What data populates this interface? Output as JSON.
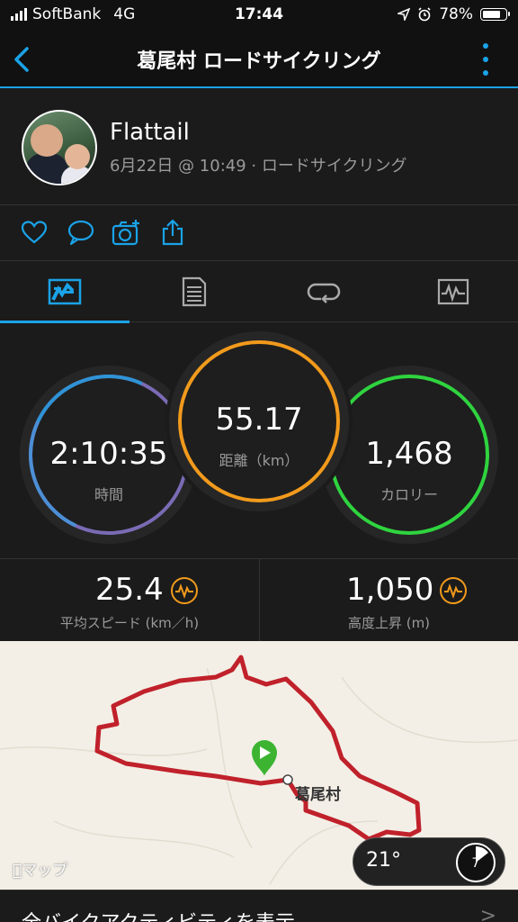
{
  "status": {
    "carrier": "SoftBank",
    "network": "4G",
    "time": "17:44",
    "battery": "78%",
    "battery_level": 0.78
  },
  "nav": {
    "title": "葛尾村 ロードサイクリング"
  },
  "profile": {
    "name": "Flattail",
    "meta": "6月22日 @ 10:49 · ロードサイクリング"
  },
  "actions": [
    "heart-icon",
    "comment-icon",
    "camera-add-icon",
    "share-icon"
  ],
  "tabs": [
    {
      "id": "summary",
      "icon": "summary-icon",
      "active": true
    },
    {
      "id": "details",
      "icon": "details-icon",
      "active": false
    },
    {
      "id": "laps",
      "icon": "laps-icon",
      "active": false
    },
    {
      "id": "charts",
      "icon": "charts-icon",
      "active": false
    }
  ],
  "stats": {
    "time": {
      "value": "2:10:35",
      "label": "時間",
      "color": "#7b6bb5"
    },
    "distance": {
      "value": "55.17",
      "label": "距離（km）",
      "color": "#f19a1c"
    },
    "calories": {
      "value": "1,468",
      "label": "カロリー",
      "color": "#2fd43f"
    }
  },
  "secondary": {
    "speed": {
      "value": "25.4",
      "label": "平均スピード (km／h)"
    },
    "elevation": {
      "value": "1,050",
      "label": "高度上昇 (m)"
    }
  },
  "map": {
    "town": "葛尾村",
    "maps_label": "マップ",
    "temperature": "21°",
    "wind": "7",
    "route_color": "#c0212b"
  },
  "footer": {
    "link": "全バイクアクティビティを表示",
    "chevron": ">"
  },
  "colors": {
    "accent": "#1aa3e8",
    "background": "#1b1b1b"
  }
}
